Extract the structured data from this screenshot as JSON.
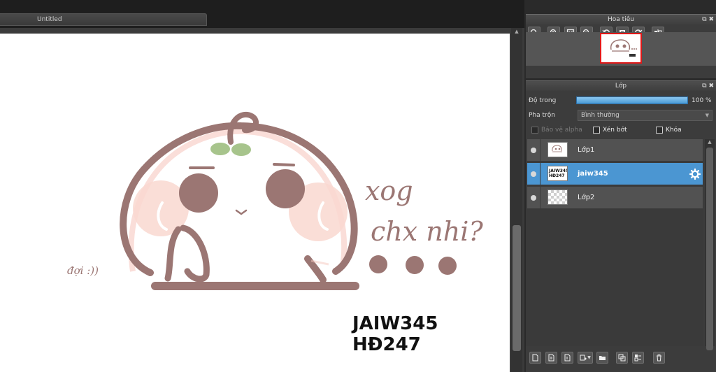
{
  "document_tab": {
    "title": "Untitled"
  },
  "canvas_text": {
    "line1": "xog",
    "line2": "chx nhi?",
    "left_note": "đợi :))",
    "watermark_line1": "JAIW345",
    "watermark_line2": "HĐ247"
  },
  "navigator_panel": {
    "title": "Hoa tiêu",
    "tools": [
      "zoom-fit-icon",
      "zoom-in-icon",
      "fit-window-icon",
      "zoom-out-icon",
      "rotate-left-icon",
      "reset-view-icon",
      "rotate-right-icon",
      "flip-icon"
    ]
  },
  "layer_panel": {
    "title": "Lớp",
    "opacity_label": "Độ trong",
    "opacity_value": 1.0,
    "opacity_text": "100 %",
    "blend_label": "Pha trộn",
    "blend_value": "Bình thường",
    "protect_alpha_label": "Bảo vệ alpha",
    "clipping_label": "Xén bớt",
    "lock_label": "Khóa",
    "layers": [
      {
        "name": "Lớp1",
        "thumb_text": ""
      },
      {
        "name": "jaiw345",
        "thumb_text": "JAIW345 HĐ247"
      },
      {
        "name": "Lớp2",
        "thumb_text": ""
      }
    ],
    "selected_index": 1
  },
  "colors": {
    "character_outline": "#9b7673",
    "leaf": "#a7c48c",
    "blush": "#f6c8bf",
    "selection": "#4b96d2",
    "opacity_bar": "#5aa8e0"
  }
}
